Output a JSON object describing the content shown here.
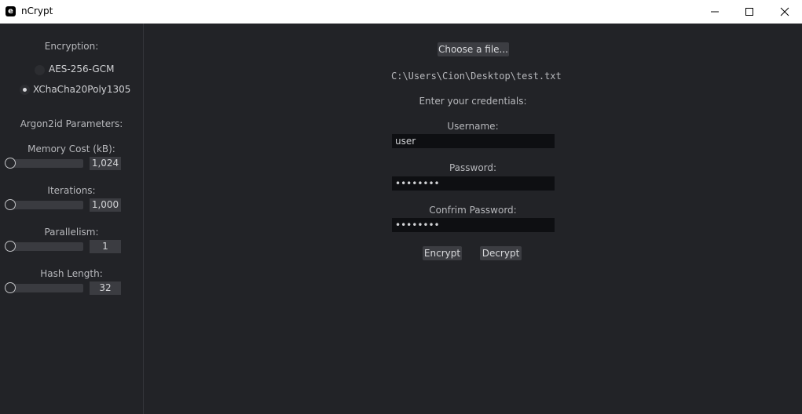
{
  "window": {
    "title": "nCrypt",
    "icon_letter": "e",
    "controls": {
      "minimize": "minimize-icon",
      "maximize": "maximize-icon",
      "close": "close-icon"
    }
  },
  "sidebar": {
    "encryption_label": "Encryption:",
    "algorithms": [
      {
        "label": "AES-256-GCM",
        "selected": false
      },
      {
        "label": "XChaCha20Poly1305",
        "selected": true
      }
    ],
    "argon_label": "Argon2id Parameters:",
    "params": [
      {
        "label": "Memory Cost (kB):",
        "value": "1,024"
      },
      {
        "label": "Iterations:",
        "value": "1,000"
      },
      {
        "label": "Parallelism:",
        "value": "1"
      },
      {
        "label": "Hash Length:",
        "value": "32"
      }
    ]
  },
  "main": {
    "choose_file_label": "Choose a file...",
    "file_path": "C:\\Users\\Cion\\Desktop\\test.txt",
    "credentials_label": "Enter your credentials:",
    "username_label": "Username:",
    "username_value": "user",
    "password_label": "Password:",
    "password_value": "••••••••",
    "confirm_label": "Confrim Password:",
    "confirm_value": "••••••••",
    "encrypt_label": "Encrypt",
    "decrypt_label": "Decrypt"
  },
  "colors": {
    "background": "#222327",
    "field_background": "#0e0f12",
    "button_background": "#3c3d42",
    "text": "#b7b8bc"
  }
}
